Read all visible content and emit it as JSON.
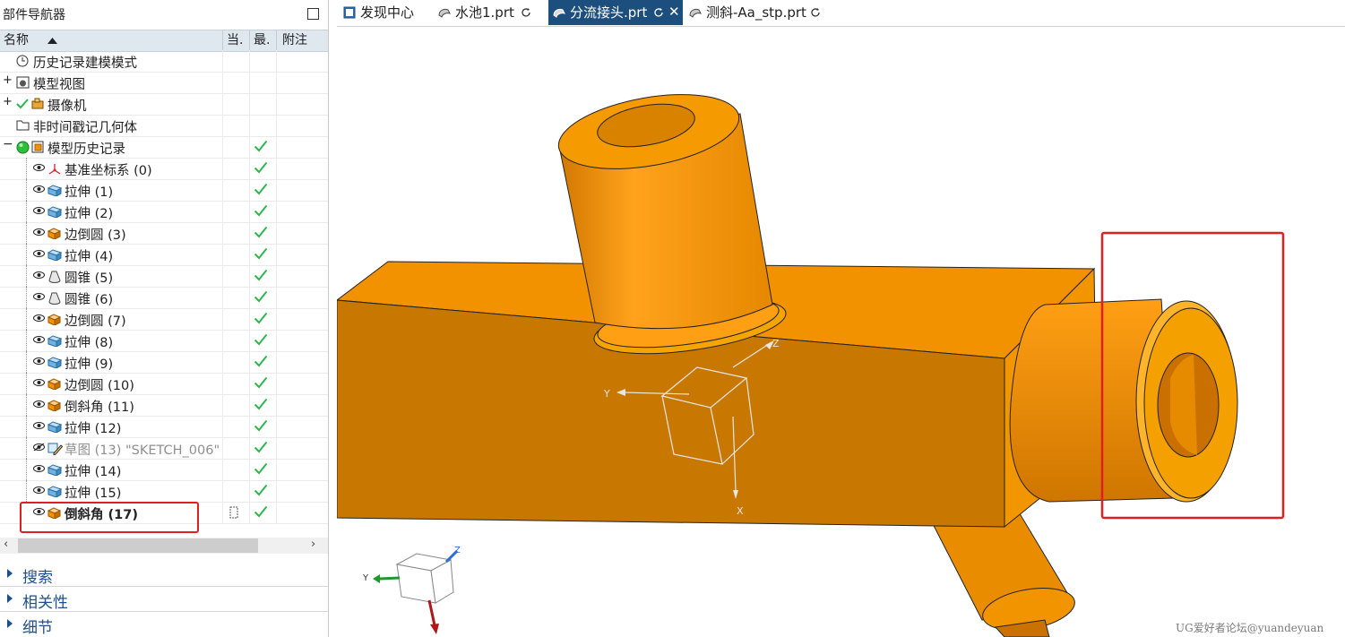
{
  "navigator": {
    "title": "部件导航器",
    "columns": {
      "name": "名称",
      "current": "当.",
      "latest": "最.",
      "notes": "附注"
    },
    "rows": [
      {
        "label": "历史记录建模模式",
        "style": "normal"
      },
      {
        "label": "模型视图",
        "style": "normal"
      },
      {
        "label": "摄像机",
        "style": "normal"
      },
      {
        "label": "非时间戳记几何体",
        "style": "normal"
      },
      {
        "label": "模型历史记录",
        "style": "normal"
      },
      {
        "label": "基准坐标系 (0)",
        "style": "normal"
      },
      {
        "label": "拉伸 (1)",
        "style": "normal"
      },
      {
        "label": "拉伸 (2)",
        "style": "normal"
      },
      {
        "label": "边倒圆 (3)",
        "style": "normal"
      },
      {
        "label": "拉伸 (4)",
        "style": "normal"
      },
      {
        "label": "圆锥 (5)",
        "style": "normal"
      },
      {
        "label": "圆锥 (6)",
        "style": "normal"
      },
      {
        "label": "边倒圆 (7)",
        "style": "normal"
      },
      {
        "label": "拉伸 (8)",
        "style": "normal"
      },
      {
        "label": "拉伸 (9)",
        "style": "normal"
      },
      {
        "label": "边倒圆 (10)",
        "style": "normal"
      },
      {
        "label": "倒斜角 (11)",
        "style": "normal"
      },
      {
        "label": "拉伸 (12)",
        "style": "normal"
      },
      {
        "label": "草图 (13) \"SKETCH_006\"",
        "style": "dim"
      },
      {
        "label": "拉伸 (14)",
        "style": "normal"
      },
      {
        "label": "拉伸 (15)",
        "style": "normal"
      },
      {
        "label": "倒斜角 (17)",
        "style": "bold"
      }
    ],
    "sections": [
      "搜索",
      "相关性",
      "细节"
    ]
  },
  "tabs": [
    {
      "label": "发现中心"
    },
    {
      "label": "水池1.prt"
    },
    {
      "label": "分流接头.prt"
    },
    {
      "label": "测斜-Aa_stp.prt"
    }
  ],
  "viewport": {
    "axis_labels": {
      "x": "X",
      "y": "Y",
      "z": "Z"
    },
    "triad_labels": {
      "y": "Y",
      "z": "Z"
    }
  },
  "watermark": "UG爱好者论坛@yuandeyuan",
  "colors": {
    "accent": "#1d4f7e",
    "model": "#f39200",
    "highlight": "#e02020",
    "check": "#2db84d"
  }
}
